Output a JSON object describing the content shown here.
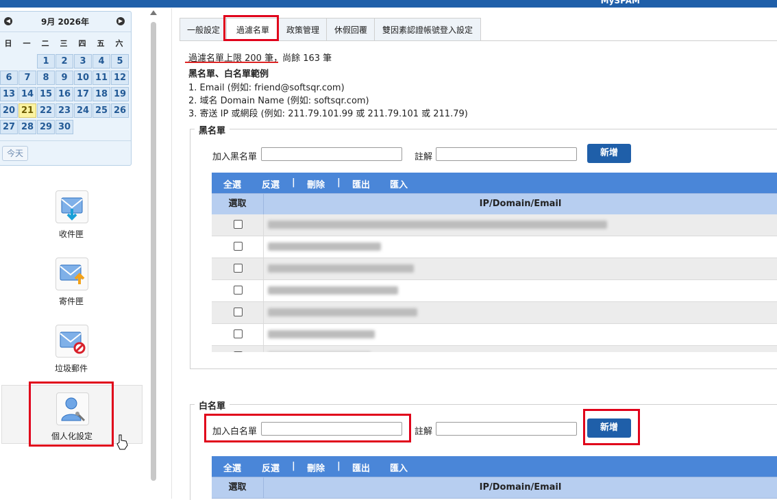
{
  "brand": "MySPAM",
  "calendar": {
    "title": "9月 2026年",
    "weekdays": [
      "日",
      "一",
      "二",
      "三",
      "四",
      "五",
      "六"
    ],
    "days": [
      "1",
      "2",
      "3",
      "4",
      "5",
      "6",
      "7",
      "8",
      "9",
      "10",
      "11",
      "12",
      "13",
      "14",
      "15",
      "16",
      "17",
      "18",
      "19",
      "20",
      "21",
      "22",
      "23",
      "24",
      "25",
      "26",
      "27",
      "28",
      "29",
      "30"
    ],
    "today_label": "今天"
  },
  "menu": {
    "inbox": "收件匣",
    "sent": "寄件匣",
    "spam": "垃圾郵件",
    "settings": "個人化設定"
  },
  "tabs": [
    "一般設定",
    "過濾名單",
    "政策管理",
    "休假回覆",
    "雙因素認證帳號登入設定"
  ],
  "info": {
    "limit_text": "過濾名單上限 200 筆",
    "remaining_text": "，尚餘 163 筆",
    "range_title": "黑名單、白名單範例",
    "line1": "1. Email (例如: friend@softsqr.com)",
    "line2": "2. 域名 Domain Name (例如: softsqr.com)",
    "line3": "3. 寄送 IP 或網段 (例如: 211.79.101.99 或 211.79.101 或 211.79)"
  },
  "blacklist": {
    "legend": "黑名單",
    "add_label": "加入黑名單",
    "note_label": "註解",
    "add_button": "新增",
    "toolbar": [
      "全選",
      "反選",
      "|",
      "刪除",
      "|",
      "匯出",
      "匯入"
    ],
    "col_select": "選取",
    "col_entry": "IP/Domain/Email"
  },
  "whitelist": {
    "legend": "白名單",
    "add_label": "加入白名單",
    "note_label": "註解",
    "add_button": "新增",
    "toolbar": [
      "全選",
      "反選",
      "|",
      "刪除",
      "|",
      "匯出",
      "匯入"
    ],
    "col_select": "選取",
    "col_entry": "IP/Domain/Email"
  }
}
